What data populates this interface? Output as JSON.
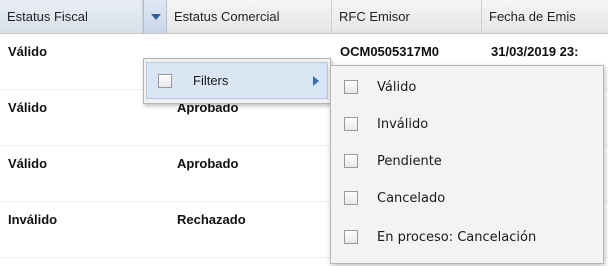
{
  "columns": [
    {
      "label": "Estatus Fiscal"
    },
    {
      "label": "Estatus Comercial"
    },
    {
      "label": "RFC Emisor"
    },
    {
      "label": "Fecha de Emis"
    }
  ],
  "rows": [
    {
      "fiscal": "Válido",
      "comercial": "",
      "rfc": "OCM0505317M0",
      "fecha": "31/03/2019 23:"
    },
    {
      "fiscal": "Válido",
      "comercial": "Aprobado"
    },
    {
      "fiscal": "Válido",
      "comercial": "Aprobado"
    },
    {
      "fiscal": "Inválido",
      "comercial": "Rechazado"
    }
  ],
  "menu": {
    "filters_label": "Filters",
    "filters_checked": false,
    "icons": {
      "trigger": "chevron-down-icon",
      "submenu": "chevron-right-icon"
    }
  },
  "filter_options": [
    {
      "label": "Válido",
      "checked": false
    },
    {
      "label": "Inválido",
      "checked": false
    },
    {
      "label": "Pendiente",
      "checked": false
    },
    {
      "label": "Cancelado",
      "checked": false
    },
    {
      "label": "En proceso: Cancelación",
      "checked": false
    }
  ]
}
